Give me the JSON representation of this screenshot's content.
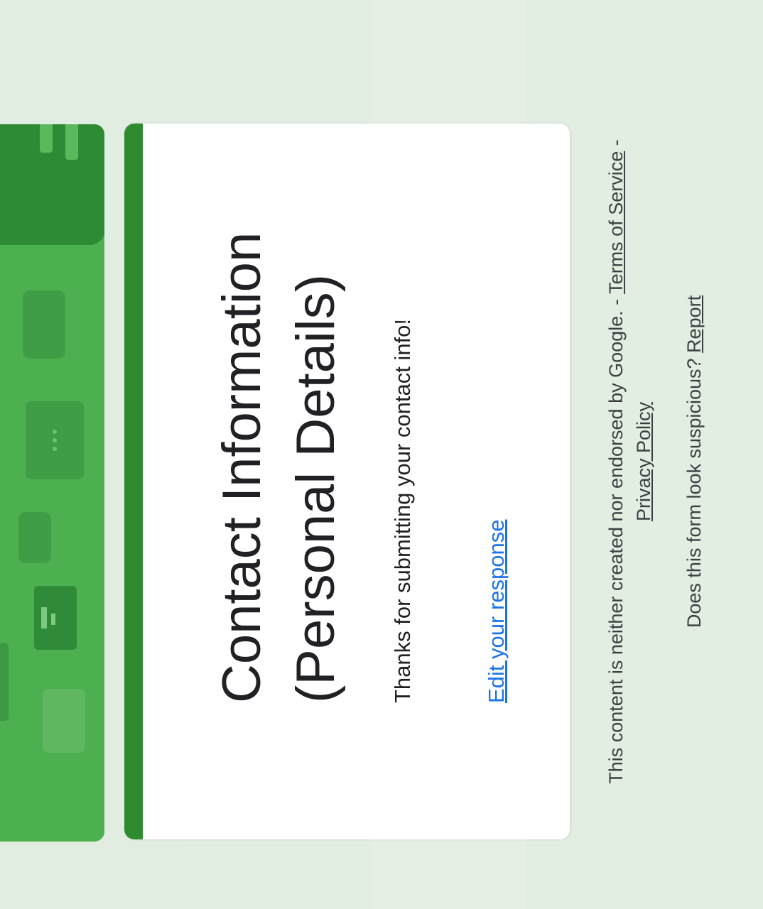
{
  "form": {
    "title": "Contact Information (Personal Details)",
    "confirmation_message": "Thanks for submitting your contact info!",
    "edit_link_label": "Edit your response"
  },
  "footer": {
    "disclaimer_text": "This content is neither created nor endorsed by Google. - ",
    "terms_label": "Terms of Service",
    "separator": " - ",
    "privacy_label": "Privacy Policy",
    "suspicious_text": "Does this form look suspicious? ",
    "report_label": "Report"
  },
  "colors": {
    "accent": "#2e8b2e",
    "banner": "#4caf50",
    "link": "#1a73e8",
    "background": "#e3eee2"
  },
  "icons": [
    "chat-bubble-icon",
    "video-camera-icon",
    "document-icon",
    "bar-chart-icon"
  ]
}
